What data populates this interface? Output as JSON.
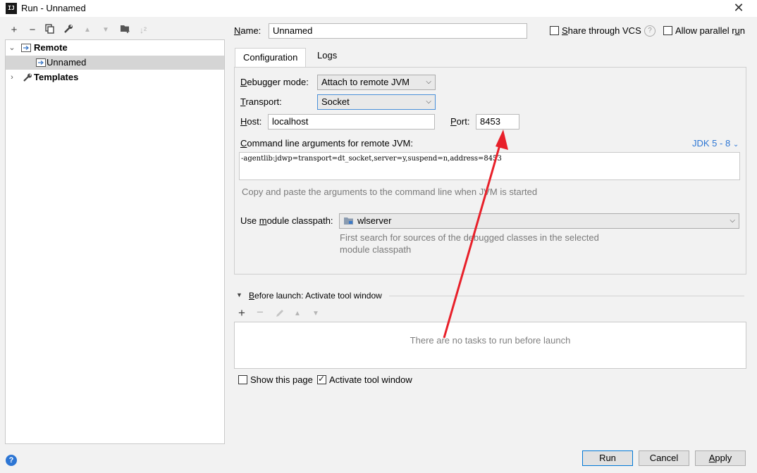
{
  "window": {
    "title": "Run - Unnamed",
    "app_icon_text": "IJ"
  },
  "toolbar": {
    "add": "+",
    "remove": "−",
    "copy": "⧉",
    "edit": "🔧",
    "up": "▲",
    "down": "▼",
    "folder": "📁",
    "sort": "↓²"
  },
  "tree": {
    "items": [
      {
        "label": "Remote",
        "bold": true
      },
      {
        "label": "Unnamed",
        "bold": false
      },
      {
        "label": "Templates",
        "bold": true
      }
    ]
  },
  "name": {
    "label_prefix": "N",
    "label_rest": "ame:",
    "value": "Unnamed"
  },
  "share_vcs": {
    "label_prefix": "S",
    "label_rest": "hare through VCS",
    "help": "?"
  },
  "allow_parallel": {
    "label_prefix": "Allow parallel r",
    "label_u": "u",
    "label_rest": "n"
  },
  "tabs": [
    {
      "label": "Configuration",
      "active": true
    },
    {
      "label": "Logs",
      "active": false
    }
  ],
  "config": {
    "debugger_mode": {
      "label_prefix": "D",
      "label_rest": "ebugger mode:",
      "value": "Attach to remote JVM"
    },
    "transport": {
      "label_prefix": "T",
      "label_rest": "ransport:",
      "value": "Socket"
    },
    "host": {
      "label_prefix": "H",
      "label_rest": "ost:",
      "value": "localhost"
    },
    "port": {
      "label_prefix": "P",
      "label_rest": "ort:",
      "value": "8453"
    },
    "cmdline": {
      "label_prefix": "C",
      "label_rest": "ommand line arguments for remote JVM:",
      "jdk": "JDK 5 - 8",
      "value": "-agentlib:jdwp=transport=dt_socket,server=y,suspend=n,address=8453",
      "hint": "Copy and paste the arguments to the command line when JVM is started"
    },
    "module_classpath": {
      "label_prefix": "Use ",
      "label_u": "m",
      "label_rest": "odule classpath:",
      "value": "wlserver",
      "hint_line1": "First search for sources of the debugged classes in the selected",
      "hint_line2": "module classpath"
    }
  },
  "before_launch": {
    "label_prefix": "B",
    "label_rest": "efore launch: Activate tool window",
    "empty_text": "There are no tasks to run before launch"
  },
  "show_page": {
    "label": "Show this page",
    "checked": false
  },
  "activate_window": {
    "label": "Activate tool window",
    "checked": true
  },
  "buttons": {
    "run": "Run",
    "cancel": "Cancel",
    "apply_prefix": "A",
    "apply_rest": "pply",
    "help": "?"
  },
  "colors": {
    "accent": "#2d76d4",
    "arrow": "#e8202a",
    "selection": "#d5d5d5"
  }
}
